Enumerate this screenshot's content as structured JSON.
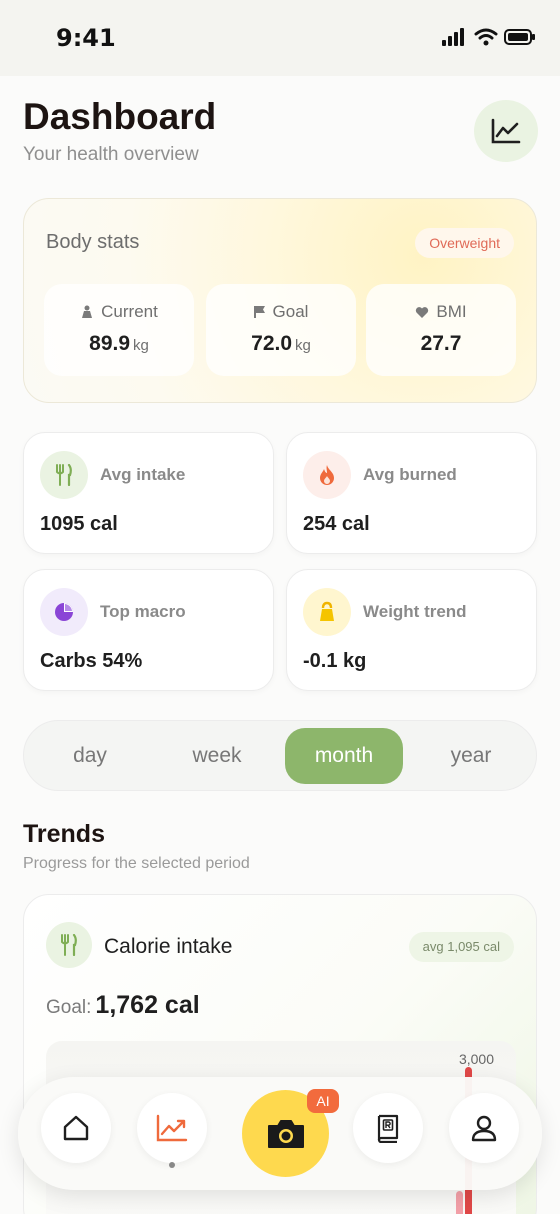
{
  "status_bar": {
    "time": "9:41"
  },
  "header": {
    "title": "Dashboard",
    "subtitle": "Your health overview",
    "chart_button_icon": "line-chart-icon"
  },
  "body_stats": {
    "title": "Body stats",
    "badge": "Overweight",
    "current": {
      "label": "Current",
      "value": "89.9",
      "unit": "kg",
      "icon": "weight-person-icon"
    },
    "goal": {
      "label": "Goal",
      "value": "72.0",
      "unit": "kg",
      "icon": "flag-icon"
    },
    "bmi": {
      "label": "BMI",
      "value": "27.7",
      "icon": "heart-icon"
    }
  },
  "metrics": [
    {
      "label": "Avg intake",
      "value": "1095 cal",
      "icon": "fork-knife-icon",
      "color": "#eaf3e2"
    },
    {
      "label": "Avg burned",
      "value": "254 cal",
      "icon": "flame-icon",
      "color": "#fdeeea"
    },
    {
      "label": "Top macro",
      "value": "Carbs 54%",
      "icon": "pie-chart-icon",
      "color": "#f1ebfb"
    },
    {
      "label": "Weight trend",
      "value": "-0.1 kg",
      "icon": "kettlebell-icon",
      "color": "#fff6cf"
    }
  ],
  "period": {
    "tabs": [
      "day",
      "week",
      "month",
      "year"
    ],
    "selected": "month",
    "accent": "#8db66b"
  },
  "trends": {
    "title": "Trends",
    "subtitle": "Progress for the selected period"
  },
  "calorie_card": {
    "title": "Calorie intake",
    "avg_badge": "avg 1,095 cal",
    "goal_label": "Goal:",
    "goal_value": "1,762 cal",
    "tick_label": "3,000"
  },
  "bottom_nav": {
    "items": [
      "home-icon",
      "trend-icon",
      "camera-icon",
      "recipe-book-icon",
      "profile-icon"
    ],
    "ai_badge": "AI"
  }
}
